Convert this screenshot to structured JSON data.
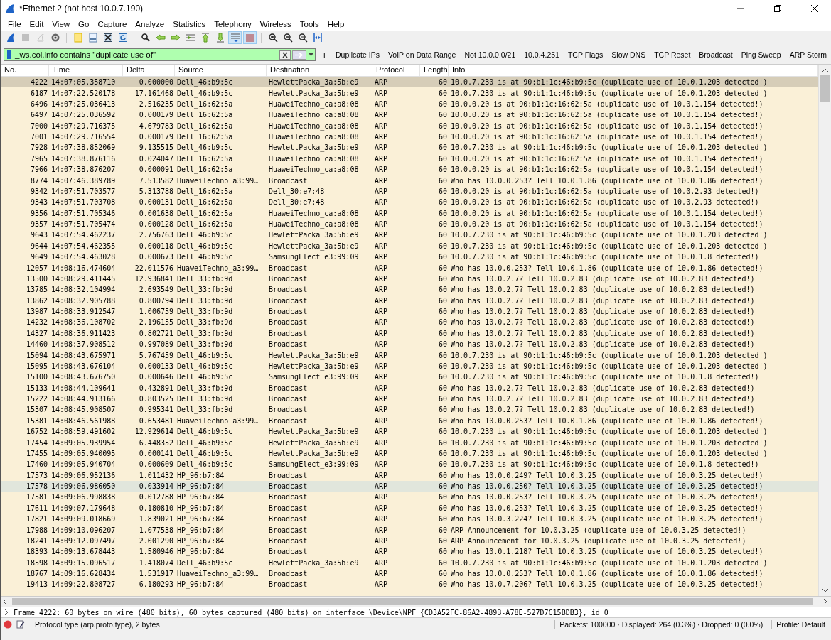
{
  "window": {
    "title": "*Ethernet 2 (not host 10.0.7.190)"
  },
  "menu": [
    "File",
    "Edit",
    "View",
    "Go",
    "Capture",
    "Analyze",
    "Statistics",
    "Telephony",
    "Wireless",
    "Tools",
    "Help"
  ],
  "toolbar": [
    [
      {
        "kind": "fin",
        "disabled": false,
        "pressed": false
      },
      {
        "kind": "stop",
        "disabled": true,
        "pressed": false
      },
      {
        "kind": "restart",
        "disabled": true,
        "pressed": false
      },
      {
        "kind": "options",
        "disabled": false,
        "pressed": false
      }
    ],
    [
      {
        "kind": "open",
        "disabled": false,
        "pressed": false
      },
      {
        "kind": "save",
        "disabled": false,
        "pressed": false
      },
      {
        "kind": "close",
        "disabled": false,
        "pressed": false
      },
      {
        "kind": "reload",
        "disabled": false,
        "pressed": false
      }
    ],
    [
      {
        "kind": "find",
        "disabled": false,
        "pressed": false
      },
      {
        "kind": "back",
        "disabled": false,
        "pressed": false
      },
      {
        "kind": "forward",
        "disabled": false,
        "pressed": false
      },
      {
        "kind": "goto",
        "disabled": false,
        "pressed": false
      },
      {
        "kind": "first",
        "disabled": false,
        "pressed": false
      },
      {
        "kind": "last",
        "disabled": false,
        "pressed": false
      },
      {
        "kind": "autoscroll",
        "disabled": false,
        "pressed": true
      },
      {
        "kind": "colorize",
        "disabled": false,
        "pressed": true
      }
    ],
    [
      {
        "kind": "zoom-in",
        "disabled": false,
        "pressed": false
      },
      {
        "kind": "zoom-out",
        "disabled": false,
        "pressed": false
      },
      {
        "kind": "zoom-normal",
        "disabled": false,
        "pressed": false
      },
      {
        "kind": "resize",
        "disabled": false,
        "pressed": false
      }
    ]
  ],
  "filter": {
    "value": "_ws.col.info contains \"duplicate use of\"",
    "valid": true,
    "add_label": "+"
  },
  "filter_buttons": [
    "Duplicate IPs",
    "VoIP on Data Range",
    "Not 10.0.0.0/21",
    "10.0.4.251",
    "TCP Flags",
    "Slow DNS",
    "TCP Reset",
    "Broadcast",
    "Ping Sweep",
    "ARP Storm"
  ],
  "table": {
    "columns": [
      "No.",
      "Time",
      "Delta",
      "Source",
      "Destination",
      "Protocol",
      "Length",
      "Info"
    ],
    "rows": [
      {
        "no": "4222",
        "time": "14:07:05.358710",
        "delta": "0.000000",
        "source": "Dell_46:b9:5c",
        "destination": "HewlettPacka_3a:5b:e9",
        "protocol": "ARP",
        "length": "60",
        "info": "10.0.7.230 is at 90:b1:1c:46:b9:5c (duplicate use of 10.0.1.203 detected!)",
        "selected": true,
        "hovered": false
      },
      {
        "no": "6187",
        "time": "14:07:22.520178",
        "delta": "17.161468",
        "source": "Dell_46:b9:5c",
        "destination": "HewlettPacka_3a:5b:e9",
        "protocol": "ARP",
        "length": "60",
        "info": "10.0.7.230 is at 90:b1:1c:46:b9:5c (duplicate use of 10.0.1.203 detected!)",
        "selected": false,
        "hovered": false
      },
      {
        "no": "6496",
        "time": "14:07:25.036413",
        "delta": "2.516235",
        "source": "Dell_16:62:5a",
        "destination": "HuaweiTechno_ca:a8:08",
        "protocol": "ARP",
        "length": "60",
        "info": "10.0.0.20 is at 90:b1:1c:16:62:5a (duplicate use of 10.0.1.154 detected!)",
        "selected": false,
        "hovered": false
      },
      {
        "no": "6497",
        "time": "14:07:25.036592",
        "delta": "0.000179",
        "source": "Dell_16:62:5a",
        "destination": "HuaweiTechno_ca:a8:08",
        "protocol": "ARP",
        "length": "60",
        "info": "10.0.0.20 is at 90:b1:1c:16:62:5a (duplicate use of 10.0.1.154 detected!)",
        "selected": false,
        "hovered": false
      },
      {
        "no": "7000",
        "time": "14:07:29.716375",
        "delta": "4.679783",
        "source": "Dell_16:62:5a",
        "destination": "HuaweiTechno_ca:a8:08",
        "protocol": "ARP",
        "length": "60",
        "info": "10.0.0.20 is at 90:b1:1c:16:62:5a (duplicate use of 10.0.1.154 detected!)",
        "selected": false,
        "hovered": false
      },
      {
        "no": "7001",
        "time": "14:07:29.716554",
        "delta": "0.000179",
        "source": "Dell_16:62:5a",
        "destination": "HuaweiTechno_ca:a8:08",
        "protocol": "ARP",
        "length": "60",
        "info": "10.0.0.20 is at 90:b1:1c:16:62:5a (duplicate use of 10.0.1.154 detected!)",
        "selected": false,
        "hovered": false
      },
      {
        "no": "7928",
        "time": "14:07:38.852069",
        "delta": "9.135515",
        "source": "Dell_46:b9:5c",
        "destination": "HewlettPacka_3a:5b:e9",
        "protocol": "ARP",
        "length": "60",
        "info": "10.0.7.230 is at 90:b1:1c:46:b9:5c (duplicate use of 10.0.1.203 detected!)",
        "selected": false,
        "hovered": false
      },
      {
        "no": "7965",
        "time": "14:07:38.876116",
        "delta": "0.024047",
        "source": "Dell_16:62:5a",
        "destination": "HuaweiTechno_ca:a8:08",
        "protocol": "ARP",
        "length": "60",
        "info": "10.0.0.20 is at 90:b1:1c:16:62:5a (duplicate use of 10.0.1.154 detected!)",
        "selected": false,
        "hovered": false
      },
      {
        "no": "7966",
        "time": "14:07:38.876207",
        "delta": "0.000091",
        "source": "Dell_16:62:5a",
        "destination": "HuaweiTechno_ca:a8:08",
        "protocol": "ARP",
        "length": "60",
        "info": "10.0.0.20 is at 90:b1:1c:16:62:5a (duplicate use of 10.0.1.154 detected!)",
        "selected": false,
        "hovered": false
      },
      {
        "no": "8774",
        "time": "14:07:46.389789",
        "delta": "7.513582",
        "source": "HuaweiTechno_a3:99…",
        "destination": "Broadcast",
        "protocol": "ARP",
        "length": "60",
        "info": "Who has 10.0.0.253? Tell 10.0.1.86 (duplicate use of 10.0.1.86 detected!)",
        "selected": false,
        "hovered": false
      },
      {
        "no": "9342",
        "time": "14:07:51.703577",
        "delta": "5.313788",
        "source": "Dell_16:62:5a",
        "destination": "Dell_30:e7:48",
        "protocol": "ARP",
        "length": "60",
        "info": "10.0.0.20 is at 90:b1:1c:16:62:5a (duplicate use of 10.0.2.93 detected!)",
        "selected": false,
        "hovered": false
      },
      {
        "no": "9343",
        "time": "14:07:51.703708",
        "delta": "0.000131",
        "source": "Dell_16:62:5a",
        "destination": "Dell_30:e7:48",
        "protocol": "ARP",
        "length": "60",
        "info": "10.0.0.20 is at 90:b1:1c:16:62:5a (duplicate use of 10.0.2.93 detected!)",
        "selected": false,
        "hovered": false
      },
      {
        "no": "9356",
        "time": "14:07:51.705346",
        "delta": "0.001638",
        "source": "Dell_16:62:5a",
        "destination": "HuaweiTechno_ca:a8:08",
        "protocol": "ARP",
        "length": "60",
        "info": "10.0.0.20 is at 90:b1:1c:16:62:5a (duplicate use of 10.0.1.154 detected!)",
        "selected": false,
        "hovered": false
      },
      {
        "no": "9357",
        "time": "14:07:51.705474",
        "delta": "0.000128",
        "source": "Dell_16:62:5a",
        "destination": "HuaweiTechno_ca:a8:08",
        "protocol": "ARP",
        "length": "60",
        "info": "10.0.0.20 is at 90:b1:1c:16:62:5a (duplicate use of 10.0.1.154 detected!)",
        "selected": false,
        "hovered": false
      },
      {
        "no": "9643",
        "time": "14:07:54.462237",
        "delta": "2.756763",
        "source": "Dell_46:b9:5c",
        "destination": "HewlettPacka_3a:5b:e9",
        "protocol": "ARP",
        "length": "60",
        "info": "10.0.7.230 is at 90:b1:1c:46:b9:5c (duplicate use of 10.0.1.203 detected!)",
        "selected": false,
        "hovered": false
      },
      {
        "no": "9644",
        "time": "14:07:54.462355",
        "delta": "0.000118",
        "source": "Dell_46:b9:5c",
        "destination": "HewlettPacka_3a:5b:e9",
        "protocol": "ARP",
        "length": "60",
        "info": "10.0.7.230 is at 90:b1:1c:46:b9:5c (duplicate use of 10.0.1.203 detected!)",
        "selected": false,
        "hovered": false
      },
      {
        "no": "9649",
        "time": "14:07:54.463028",
        "delta": "0.000673",
        "source": "Dell_46:b9:5c",
        "destination": "SamsungElect_e3:99:09",
        "protocol": "ARP",
        "length": "60",
        "info": "10.0.7.230 is at 90:b1:1c:46:b9:5c (duplicate use of 10.0.1.8 detected!)",
        "selected": false,
        "hovered": false
      },
      {
        "no": "12057",
        "time": "14:08:16.474604",
        "delta": "22.011576",
        "source": "HuaweiTechno_a3:99…",
        "destination": "Broadcast",
        "protocol": "ARP",
        "length": "60",
        "info": "Who has 10.0.0.253? Tell 10.0.1.86 (duplicate use of 10.0.1.86 detected!)",
        "selected": false,
        "hovered": false
      },
      {
        "no": "13500",
        "time": "14:08:29.411445",
        "delta": "12.936841",
        "source": "Dell_33:fb:9d",
        "destination": "Broadcast",
        "protocol": "ARP",
        "length": "60",
        "info": "Who has 10.0.2.7? Tell 10.0.2.83 (duplicate use of 10.0.2.83 detected!)",
        "selected": false,
        "hovered": false
      },
      {
        "no": "13785",
        "time": "14:08:32.104994",
        "delta": "2.693549",
        "source": "Dell_33:fb:9d",
        "destination": "Broadcast",
        "protocol": "ARP",
        "length": "60",
        "info": "Who has 10.0.2.7? Tell 10.0.2.83 (duplicate use of 10.0.2.83 detected!)",
        "selected": false,
        "hovered": false
      },
      {
        "no": "13862",
        "time": "14:08:32.905788",
        "delta": "0.800794",
        "source": "Dell_33:fb:9d",
        "destination": "Broadcast",
        "protocol": "ARP",
        "length": "60",
        "info": "Who has 10.0.2.7? Tell 10.0.2.83 (duplicate use of 10.0.2.83 detected!)",
        "selected": false,
        "hovered": false
      },
      {
        "no": "13987",
        "time": "14:08:33.912547",
        "delta": "1.006759",
        "source": "Dell_33:fb:9d",
        "destination": "Broadcast",
        "protocol": "ARP",
        "length": "60",
        "info": "Who has 10.0.2.7? Tell 10.0.2.83 (duplicate use of 10.0.2.83 detected!)",
        "selected": false,
        "hovered": false
      },
      {
        "no": "14232",
        "time": "14:08:36.108702",
        "delta": "2.196155",
        "source": "Dell_33:fb:9d",
        "destination": "Broadcast",
        "protocol": "ARP",
        "length": "60",
        "info": "Who has 10.0.2.7? Tell 10.0.2.83 (duplicate use of 10.0.2.83 detected!)",
        "selected": false,
        "hovered": false
      },
      {
        "no": "14327",
        "time": "14:08:36.911423",
        "delta": "0.802721",
        "source": "Dell_33:fb:9d",
        "destination": "Broadcast",
        "protocol": "ARP",
        "length": "60",
        "info": "Who has 10.0.2.7? Tell 10.0.2.83 (duplicate use of 10.0.2.83 detected!)",
        "selected": false,
        "hovered": false
      },
      {
        "no": "14460",
        "time": "14:08:37.908512",
        "delta": "0.997089",
        "source": "Dell_33:fb:9d",
        "destination": "Broadcast",
        "protocol": "ARP",
        "length": "60",
        "info": "Who has 10.0.2.7? Tell 10.0.2.83 (duplicate use of 10.0.2.83 detected!)",
        "selected": false,
        "hovered": false
      },
      {
        "no": "15094",
        "time": "14:08:43.675971",
        "delta": "5.767459",
        "source": "Dell_46:b9:5c",
        "destination": "HewlettPacka_3a:5b:e9",
        "protocol": "ARP",
        "length": "60",
        "info": "10.0.7.230 is at 90:b1:1c:46:b9:5c (duplicate use of 10.0.1.203 detected!)",
        "selected": false,
        "hovered": false
      },
      {
        "no": "15095",
        "time": "14:08:43.676104",
        "delta": "0.000133",
        "source": "Dell_46:b9:5c",
        "destination": "HewlettPacka_3a:5b:e9",
        "protocol": "ARP",
        "length": "60",
        "info": "10.0.7.230 is at 90:b1:1c:46:b9:5c (duplicate use of 10.0.1.203 detected!)",
        "selected": false,
        "hovered": false
      },
      {
        "no": "15100",
        "time": "14:08:43.676750",
        "delta": "0.000646",
        "source": "Dell_46:b9:5c",
        "destination": "SamsungElect_e3:99:09",
        "protocol": "ARP",
        "length": "60",
        "info": "10.0.7.230 is at 90:b1:1c:46:b9:5c (duplicate use of 10.0.1.8 detected!)",
        "selected": false,
        "hovered": false
      },
      {
        "no": "15133",
        "time": "14:08:44.109641",
        "delta": "0.432891",
        "source": "Dell_33:fb:9d",
        "destination": "Broadcast",
        "protocol": "ARP",
        "length": "60",
        "info": "Who has 10.0.2.7? Tell 10.0.2.83 (duplicate use of 10.0.2.83 detected!)",
        "selected": false,
        "hovered": false
      },
      {
        "no": "15222",
        "time": "14:08:44.913166",
        "delta": "0.803525",
        "source": "Dell_33:fb:9d",
        "destination": "Broadcast",
        "protocol": "ARP",
        "length": "60",
        "info": "Who has 10.0.2.7? Tell 10.0.2.83 (duplicate use of 10.0.2.83 detected!)",
        "selected": false,
        "hovered": false
      },
      {
        "no": "15307",
        "time": "14:08:45.908507",
        "delta": "0.995341",
        "source": "Dell_33:fb:9d",
        "destination": "Broadcast",
        "protocol": "ARP",
        "length": "60",
        "info": "Who has 10.0.2.7? Tell 10.0.2.83 (duplicate use of 10.0.2.83 detected!)",
        "selected": false,
        "hovered": false
      },
      {
        "no": "15381",
        "time": "14:08:46.561988",
        "delta": "0.653481",
        "source": "HuaweiTechno_a3:99…",
        "destination": "Broadcast",
        "protocol": "ARP",
        "length": "60",
        "info": "Who has 10.0.0.253? Tell 10.0.1.86 (duplicate use of 10.0.1.86 detected!)",
        "selected": false,
        "hovered": false
      },
      {
        "no": "16752",
        "time": "14:08:59.491602",
        "delta": "12.929614",
        "source": "Dell_46:b9:5c",
        "destination": "HewlettPacka_3a:5b:e9",
        "protocol": "ARP",
        "length": "60",
        "info": "10.0.7.230 is at 90:b1:1c:46:b9:5c (duplicate use of 10.0.1.203 detected!)",
        "selected": false,
        "hovered": false
      },
      {
        "no": "17454",
        "time": "14:09:05.939954",
        "delta": "6.448352",
        "source": "Dell_46:b9:5c",
        "destination": "HewlettPacka_3a:5b:e9",
        "protocol": "ARP",
        "length": "60",
        "info": "10.0.7.230 is at 90:b1:1c:46:b9:5c (duplicate use of 10.0.1.203 detected!)",
        "selected": false,
        "hovered": false
      },
      {
        "no": "17455",
        "time": "14:09:05.940095",
        "delta": "0.000141",
        "source": "Dell_46:b9:5c",
        "destination": "HewlettPacka_3a:5b:e9",
        "protocol": "ARP",
        "length": "60",
        "info": "10.0.7.230 is at 90:b1:1c:46:b9:5c (duplicate use of 10.0.1.203 detected!)",
        "selected": false,
        "hovered": false
      },
      {
        "no": "17460",
        "time": "14:09:05.940704",
        "delta": "0.000609",
        "source": "Dell_46:b9:5c",
        "destination": "SamsungElect_e3:99:09",
        "protocol": "ARP",
        "length": "60",
        "info": "10.0.7.230 is at 90:b1:1c:46:b9:5c (duplicate use of 10.0.1.8 detected!)",
        "selected": false,
        "hovered": false
      },
      {
        "no": "17573",
        "time": "14:09:06.952136",
        "delta": "1.011432",
        "source": "HP_96:b7:84",
        "destination": "Broadcast",
        "protocol": "ARP",
        "length": "60",
        "info": "Who has 10.0.0.249? Tell 10.0.3.25 (duplicate use of 10.0.3.25 detected!)",
        "selected": false,
        "hovered": false
      },
      {
        "no": "17578",
        "time": "14:09:06.986050",
        "delta": "0.033914",
        "source": "HP_96:b7:84",
        "destination": "Broadcast",
        "protocol": "ARP",
        "length": "60",
        "info": "Who has 10.0.0.250? Tell 10.0.3.25 (duplicate use of 10.0.3.25 detected!)",
        "selected": false,
        "hovered": true
      },
      {
        "no": "17581",
        "time": "14:09:06.998838",
        "delta": "0.012788",
        "source": "HP_96:b7:84",
        "destination": "Broadcast",
        "protocol": "ARP",
        "length": "60",
        "info": "Who has 10.0.0.253? Tell 10.0.3.25 (duplicate use of 10.0.3.25 detected!)",
        "selected": false,
        "hovered": false
      },
      {
        "no": "17611",
        "time": "14:09:07.179648",
        "delta": "0.180810",
        "source": "HP_96:b7:84",
        "destination": "Broadcast",
        "protocol": "ARP",
        "length": "60",
        "info": "Who has 10.0.0.253? Tell 10.0.3.25 (duplicate use of 10.0.3.25 detected!)",
        "selected": false,
        "hovered": false
      },
      {
        "no": "17821",
        "time": "14:09:09.018669",
        "delta": "1.839021",
        "source": "HP_96:b7:84",
        "destination": "Broadcast",
        "protocol": "ARP",
        "length": "60",
        "info": "Who has 10.0.3.224? Tell 10.0.3.25 (duplicate use of 10.0.3.25 detected!)",
        "selected": false,
        "hovered": false
      },
      {
        "no": "17988",
        "time": "14:09:10.096207",
        "delta": "1.077538",
        "source": "HP_96:b7:84",
        "destination": "Broadcast",
        "protocol": "ARP",
        "length": "60",
        "info": "ARP Announcement for 10.0.3.25 (duplicate use of 10.0.3.25 detected!)",
        "selected": false,
        "hovered": false
      },
      {
        "no": "18241",
        "time": "14:09:12.097497",
        "delta": "2.001290",
        "source": "HP_96:b7:84",
        "destination": "Broadcast",
        "protocol": "ARP",
        "length": "60",
        "info": "ARP Announcement for 10.0.3.25 (duplicate use of 10.0.3.25 detected!)",
        "selected": false,
        "hovered": false
      },
      {
        "no": "18393",
        "time": "14:09:13.678443",
        "delta": "1.580946",
        "source": "HP_96:b7:84",
        "destination": "Broadcast",
        "protocol": "ARP",
        "length": "60",
        "info": "Who has 10.0.1.218? Tell 10.0.3.25 (duplicate use of 10.0.3.25 detected!)",
        "selected": false,
        "hovered": false
      },
      {
        "no": "18598",
        "time": "14:09:15.096517",
        "delta": "1.418074",
        "source": "Dell_46:b9:5c",
        "destination": "HewlettPacka_3a:5b:e9",
        "protocol": "ARP",
        "length": "60",
        "info": "10.0.7.230 is at 90:b1:1c:46:b9:5c (duplicate use of 10.0.1.203 detected!)",
        "selected": false,
        "hovered": false
      },
      {
        "no": "18767",
        "time": "14:09:16.628434",
        "delta": "1.531917",
        "source": "HuaweiTechno_a3:99…",
        "destination": "Broadcast",
        "protocol": "ARP",
        "length": "60",
        "info": "Who has 10.0.0.253? Tell 10.0.1.86 (duplicate use of 10.0.1.86 detected!)",
        "selected": false,
        "hovered": false
      },
      {
        "no": "19413",
        "time": "14:09:22.808727",
        "delta": "6.180293",
        "source": "HP_96:b7:84",
        "destination": "Broadcast",
        "protocol": "ARP",
        "length": "60",
        "info": "Who has 10.0.7.206? Tell 10.0.3.25 (duplicate use of 10.0.3.25 detected!)",
        "selected": false,
        "hovered": false
      }
    ]
  },
  "details": {
    "expanded": false,
    "text": "Frame 4222: 60 bytes on wire (480 bits), 60 bytes captured (480 bits) on interface \\Device\\NPF_{CD3A52FC-86A2-489B-A78E-527D7C15BDB3}, id 0"
  },
  "status_bar": {
    "field": "Protocol type (arp.proto.type), 2 bytes",
    "packets": "Packets: 100000 · Displayed: 264 (0.3%) · Dropped: 0 (0.0%)",
    "profile": "Profile: Default"
  }
}
